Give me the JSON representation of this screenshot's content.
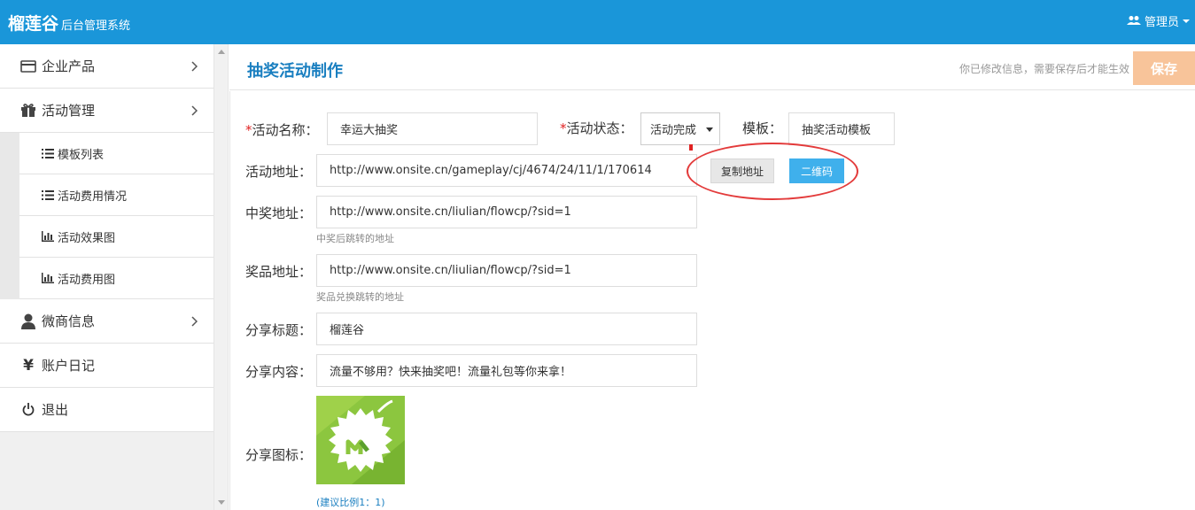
{
  "header": {
    "brand": "榴莲谷",
    "subtitle": "后台管理系统",
    "user_label": "管理员"
  },
  "sidebar": {
    "items": [
      {
        "label": "企业产品",
        "icon": "card-icon"
      },
      {
        "label": "活动管理",
        "icon": "gift-icon"
      },
      {
        "label": "微商信息",
        "icon": "user-icon"
      },
      {
        "label": "账户日记",
        "icon": "yen-icon"
      },
      {
        "label": "退出",
        "icon": "power-icon"
      }
    ],
    "subitems": [
      {
        "label": "模板列表",
        "icon": "list-icon"
      },
      {
        "label": "活动费用情况",
        "icon": "list-icon"
      },
      {
        "label": "活动效果图",
        "icon": "bar-chart-icon"
      },
      {
        "label": "活动费用图",
        "icon": "bar-chart-icon"
      }
    ]
  },
  "main": {
    "title": "抽奖活动制作",
    "notice": "你已修改信息，需要保存后才能生效",
    "save_label": "保存"
  },
  "form": {
    "req_mark": "*",
    "name_label": "活动名称：",
    "name_value": "幸运大抽奖",
    "status_label": "活动状态：",
    "status_value": "活动完成",
    "template_label": "模板：",
    "template_value": "抽奖活动模板",
    "url_label": "活动地址：",
    "url_value": "http://www.onsite.cn/gameplay/cj/4674/24/11/1/170614",
    "copy_btn": "复制地址",
    "qr_btn": "二维码",
    "win_label": "中奖地址：",
    "win_value": "http://www.onsite.cn/liulian/flowcp/?sid=1",
    "win_hint": "中奖后跳转的地址",
    "prize_label": "奖品地址：",
    "prize_value": "http://www.onsite.cn/liulian/flowcp/?sid=1",
    "prize_hint": "奖品兑换跳转的地址",
    "share_title_label": "分享标题：",
    "share_title_value": "榴莲谷",
    "share_content_label": "分享内容：",
    "share_content_value": "流量不够用？快来抽奖吧！流量礼包等你来拿！",
    "share_icon_label": "分享图标：",
    "ratio_hint": "(建议比例1：1)"
  },
  "colors": {
    "topbar": "#1a96d9",
    "title": "#1a7fc0",
    "save": "#f8c49a",
    "qr_button": "#3fb0ec",
    "highlight": "#e33b3b"
  }
}
